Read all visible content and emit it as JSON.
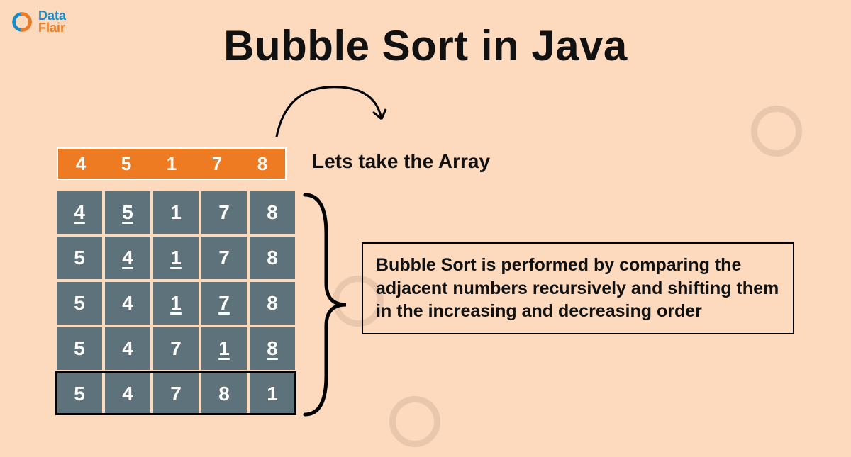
{
  "logo": {
    "line1": "Data",
    "line2": "Flair"
  },
  "title": "Bubble Sort in Java",
  "header_row": [
    "4",
    "5",
    "1",
    "7",
    "8"
  ],
  "header_label": "Lets take the Array",
  "grid_rows": [
    [
      {
        "v": "4",
        "u": true
      },
      {
        "v": "5",
        "u": true
      },
      {
        "v": "1",
        "u": false
      },
      {
        "v": "7",
        "u": false
      },
      {
        "v": "8",
        "u": false
      }
    ],
    [
      {
        "v": "5",
        "u": false
      },
      {
        "v": "4",
        "u": true
      },
      {
        "v": "1",
        "u": true
      },
      {
        "v": "7",
        "u": false
      },
      {
        "v": "8",
        "u": false
      }
    ],
    [
      {
        "v": "5",
        "u": false
      },
      {
        "v": "4",
        "u": false
      },
      {
        "v": "1",
        "u": true
      },
      {
        "v": "7",
        "u": true
      },
      {
        "v": "8",
        "u": false
      }
    ],
    [
      {
        "v": "5",
        "u": false
      },
      {
        "v": "4",
        "u": false
      },
      {
        "v": "7",
        "u": false
      },
      {
        "v": "1",
        "u": true
      },
      {
        "v": "8",
        "u": true
      }
    ],
    [
      {
        "v": "5",
        "u": false
      },
      {
        "v": "4",
        "u": false
      },
      {
        "v": "7",
        "u": false
      },
      {
        "v": "8",
        "u": false
      },
      {
        "v": "1",
        "u": false
      }
    ]
  ],
  "description": "Bubble Sort is performed by comparing the adjacent numbers recursively and shifting them in the increasing and decreasing order"
}
